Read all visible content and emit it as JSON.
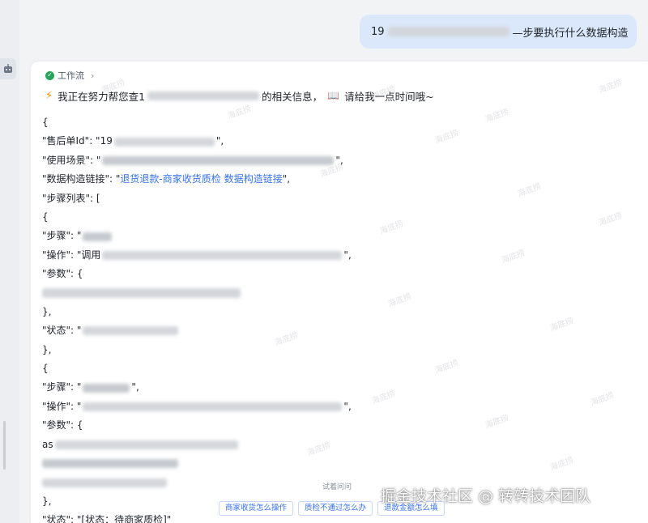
{
  "user_message": {
    "prefix": "19",
    "suffix": "—步要执行什么数据构造"
  },
  "workflow": {
    "label": "工作流"
  },
  "status_line": {
    "prefix": "我正在努力帮您查1",
    "middle": "的相关信息，",
    "tail": "请给我一点时间哦~"
  },
  "code": {
    "open_brace": "{",
    "k_order": "\"售后单Id\": \"19",
    "trail_comma": "\",",
    "k_scene": "\"使用场景\": \"",
    "k_link": "\"数据构造链接\": \"",
    "link_a": "退货退款-商家收货质检",
    "link_b": "数据构造链接",
    "k_steps": "\"步骤列表\": [",
    "obj_open": "{",
    "k_step": "\"步骤\": \"",
    "k_op": "\"操作\": \"调用",
    "k_op2": "\"操作\": \"",
    "k_params": "\"参数\": {",
    "obj_close": "},",
    "k_status": "\"状态\": \"",
    "k_status_fixed": "\"状态\": \"[状态：待商家质检]\"",
    "params_prefix": "as"
  },
  "suggestions": {
    "title": "试着问问",
    "items": [
      "商家收货怎么操作",
      "质检不通过怎么办",
      "退款金额怎么填"
    ]
  },
  "watermark": {
    "repeat_text": "海底捞",
    "brand": "掘金技术社区 @ 转转技术团队"
  },
  "colors": {
    "link": "#3370ff",
    "bubble": "#dbe8fb",
    "check": "#23a55a",
    "bolt": "#ff8a00"
  }
}
